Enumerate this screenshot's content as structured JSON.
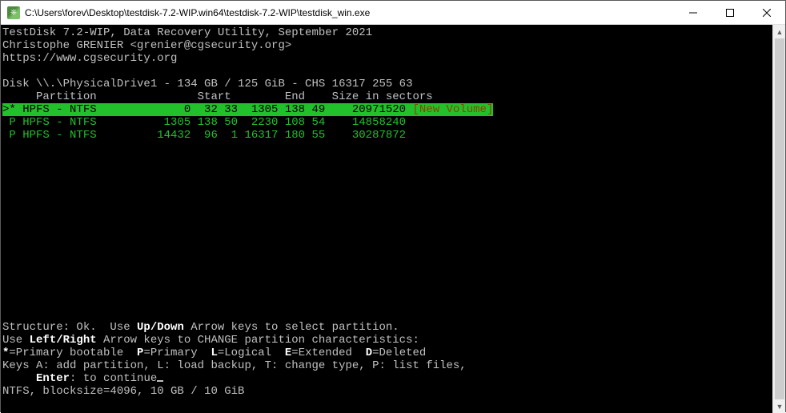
{
  "titlebar": {
    "text": "C:\\Users\\forev\\Desktop\\testdisk-7.2-WIP.win64\\testdisk-7.2-WIP\\testdisk_win.exe"
  },
  "header": {
    "line1": "TestDisk 7.2-WIP, Data Recovery Utility, September 2021",
    "line2": "Christophe GRENIER <grenier@cgsecurity.org>",
    "line3": "https://www.cgsecurity.org"
  },
  "disk": {
    "line": "Disk \\\\.\\PhysicalDrive1 - 134 GB / 125 GiB - CHS 16317 255 63",
    "cols": "     Partition               Start        End    Size in sectors"
  },
  "partitions": [
    {
      "selected": true,
      "marker": ">",
      "flag": "*",
      "type": "HPFS - NTFS",
      "start": "   0  32 33",
      "end": " 1305 138 49",
      "size": "20971520",
      "label": "[New Volume]"
    },
    {
      "selected": false,
      "marker": " ",
      "flag": "P",
      "type": "HPFS - NTFS",
      "start": "1305 138 50",
      "end": " 2230 108 54",
      "size": "14858240",
      "label": ""
    },
    {
      "selected": false,
      "marker": " ",
      "flag": "P",
      "type": "HPFS - NTFS",
      "start": "14432  96  1",
      "end": "16317 180 55",
      "size": "30287872",
      "label": ""
    }
  ],
  "footer": {
    "s1a": "Structure: Ok.  Use ",
    "s1b": "Up/Down",
    "s1c": " Arrow keys to select partition.",
    "s2a": "Use ",
    "s2b": "Left/Right",
    "s2c": " Arrow keys to CHANGE partition characteristics:",
    "s3a": "*",
    "s3b": "=Primary bootable  ",
    "s3c": "P",
    "s3d": "=Primary  ",
    "s3e": "L",
    "s3f": "=Logical  ",
    "s3g": "E",
    "s3h": "=Extended  ",
    "s3i": "D",
    "s3j": "=Deleted",
    "s4": "Keys A: add partition, L: load backup, T: change type, P: list files,",
    "s5a": "     ",
    "s5b": "Enter",
    "s5c": ": to continue",
    "s6": "NTFS, blocksize=4096, 10 GB / 10 GiB"
  }
}
